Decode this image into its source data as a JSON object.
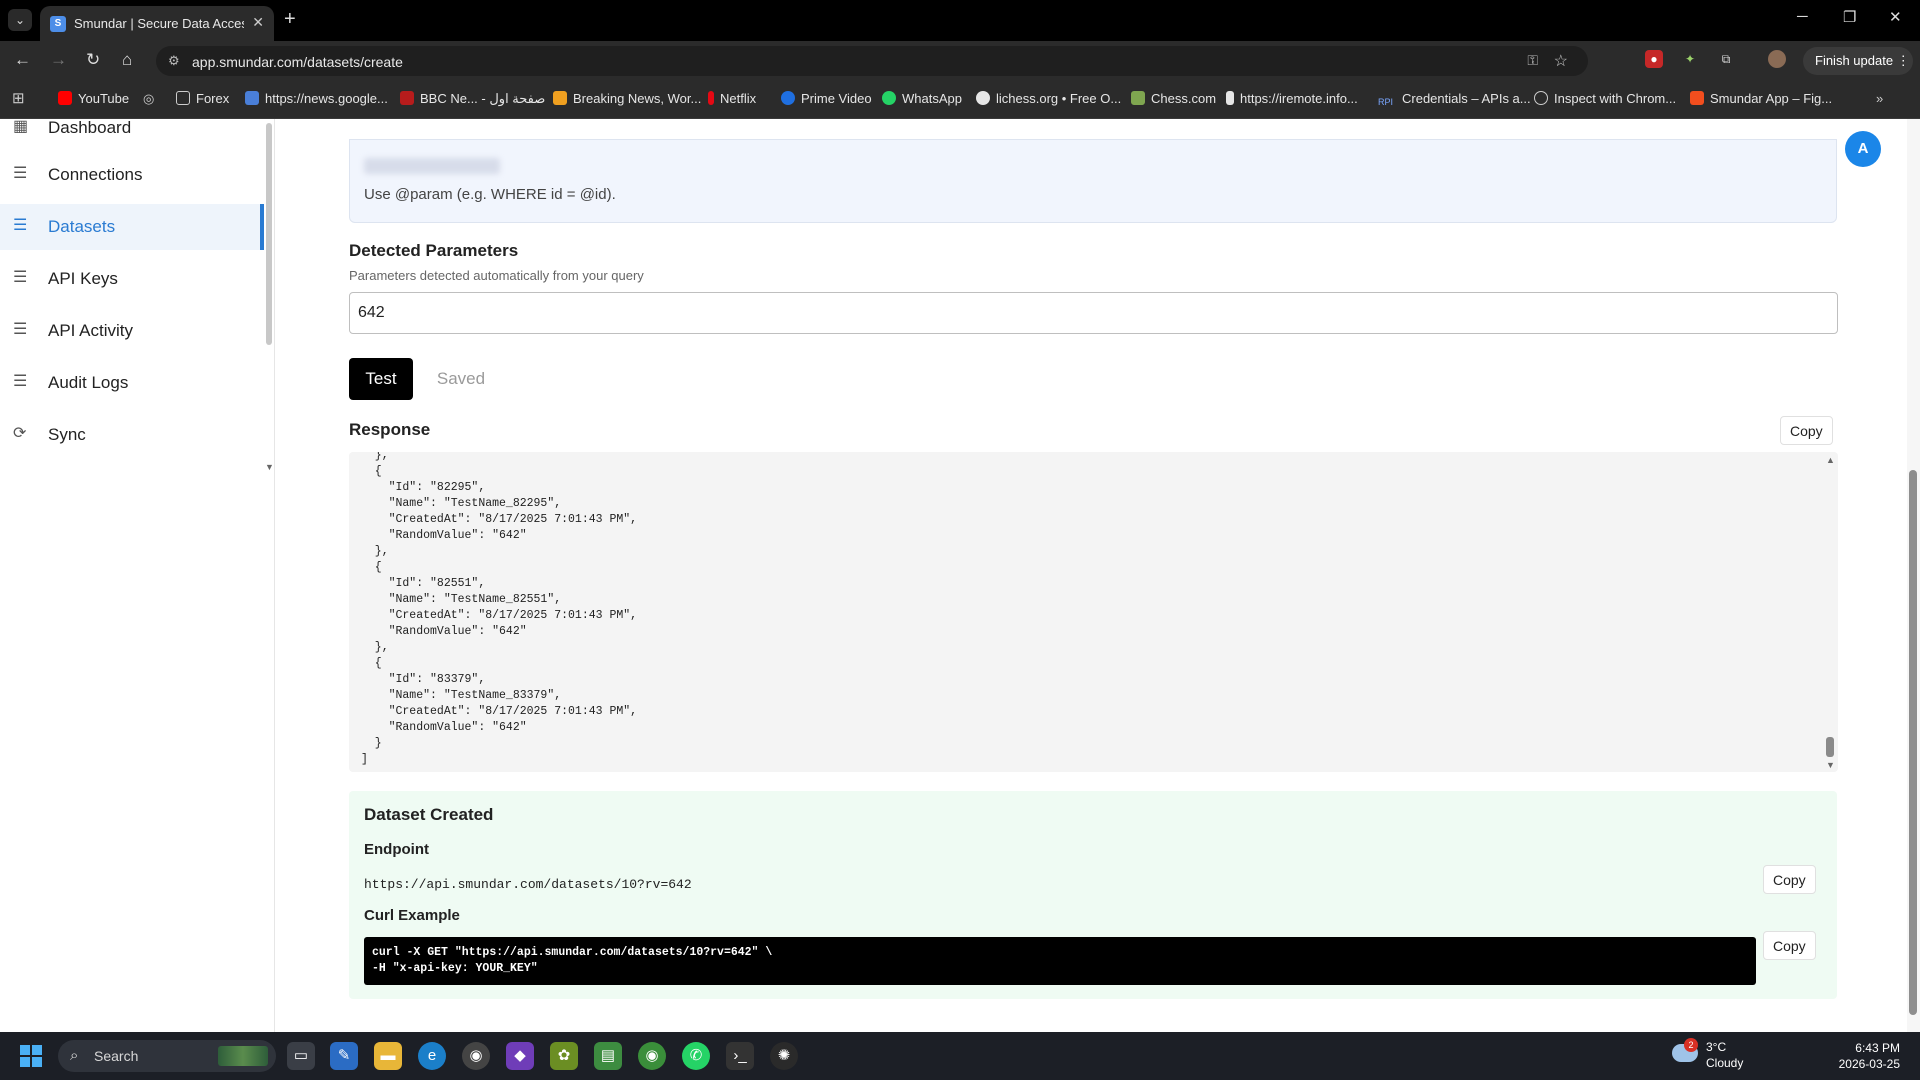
{
  "browser": {
    "tab_title": "Smundar | Secure Data Access",
    "url": "app.smundar.com/datasets/create",
    "finish_update_label": "Finish update",
    "bookmarks": [
      "YouTube",
      "Forex",
      "https://news.google...",
      "BBC Ne... - صفحة اول",
      "Breaking News, Wor...",
      "Netflix",
      "Prime Video",
      "WhatsApp",
      "lichess.org • Free O...",
      "Chess.com",
      "https://iremote.info...",
      "Credentials – APIs a...",
      "Inspect with Chrom...",
      "Smundar App – Fig..."
    ]
  },
  "sidebar": {
    "items": [
      {
        "label": "Dashboard",
        "icon": "dashboard-icon"
      },
      {
        "label": "Connections",
        "icon": "list-icon"
      },
      {
        "label": "Datasets",
        "icon": "list-icon",
        "active": true
      },
      {
        "label": "API Keys",
        "icon": "list-icon"
      },
      {
        "label": "API Activity",
        "icon": "list-icon"
      },
      {
        "label": "Audit Logs",
        "icon": "list-icon"
      },
      {
        "label": "Sync",
        "icon": "sync-icon"
      }
    ]
  },
  "avatar_initial": "A",
  "query_hint": "Use @param (e.g. WHERE id = @id).",
  "params": {
    "title": "Detected Parameters",
    "subtitle": "Parameters detected automatically from your query",
    "value": "642"
  },
  "buttons": {
    "test": "Test",
    "saved": "Saved",
    "copy": "Copy"
  },
  "response": {
    "title": "Response",
    "body": "  },\n  {\n    \"Id\": \"82295\",\n    \"Name\": \"TestName_82295\",\n    \"CreatedAt\": \"8/17/2025 7:01:43 PM\",\n    \"RandomValue\": \"642\"\n  },\n  {\n    \"Id\": \"82551\",\n    \"Name\": \"TestName_82551\",\n    \"CreatedAt\": \"8/17/2025 7:01:43 PM\",\n    \"RandomValue\": \"642\"\n  },\n  {\n    \"Id\": \"83379\",\n    \"Name\": \"TestName_83379\",\n    \"CreatedAt\": \"8/17/2025 7:01:43 PM\",\n    \"RandomValue\": \"642\"\n  }\n]"
  },
  "dataset_created": {
    "title": "Dataset Created",
    "endpoint_label": "Endpoint",
    "endpoint": "https://api.smundar.com/datasets/10?rv=642",
    "curl_label": "Curl Example",
    "curl": "curl -X GET \"https://api.smundar.com/datasets/10?rv=642\" \\\n-H \"x-api-key: YOUR_KEY\""
  },
  "taskbar": {
    "search_placeholder": "Search",
    "weather_temp": "3°C",
    "weather_cond": "Cloudy",
    "weather_badge": "2",
    "time": "6:43 PM",
    "date": "2026-03-25"
  }
}
